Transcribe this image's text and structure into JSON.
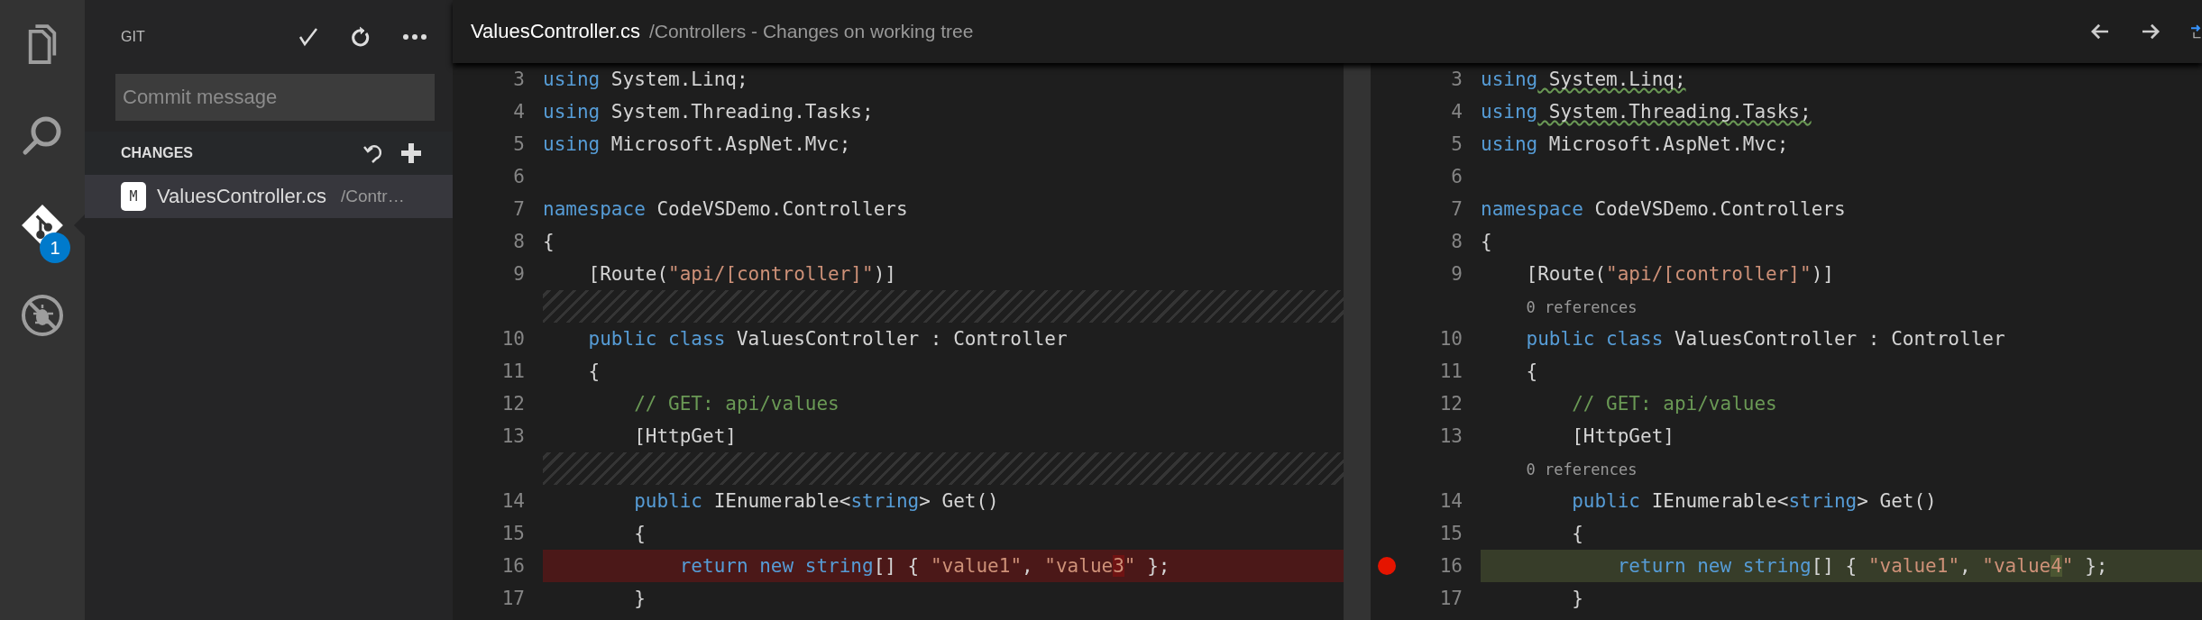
{
  "activity_bar": {
    "items": [
      {
        "kind": "files",
        "selected": false
      },
      {
        "kind": "search",
        "selected": false
      },
      {
        "kind": "git",
        "selected": true,
        "badge": "1"
      },
      {
        "kind": "debug",
        "selected": false
      }
    ]
  },
  "sidebar": {
    "title": "GIT",
    "commit_message": {
      "placeholder": "Commit message"
    },
    "section": {
      "title": "CHANGES"
    },
    "files": [
      {
        "status": "M",
        "name": "ValuesController.cs",
        "path": "/Contr…",
        "selected": true
      }
    ]
  },
  "editor": {
    "title": "ValuesController.cs",
    "description": "/Controllers - Changes on working tree",
    "panes": [
      {
        "lines": [
          {
            "kind": "code",
            "number": "3",
            "changed": false,
            "tokens": [
              {
                "kind": "keyword",
                "text": "using"
              },
              {
                "kind": "plain",
                "text": " System.Linq;"
              }
            ]
          },
          {
            "kind": "code",
            "number": "4",
            "changed": false,
            "tokens": [
              {
                "kind": "keyword",
                "text": "using"
              },
              {
                "kind": "plain",
                "text": " System.Threading.Tasks;"
              }
            ]
          },
          {
            "kind": "code",
            "number": "5",
            "changed": false,
            "tokens": [
              {
                "kind": "keyword",
                "text": "using"
              },
              {
                "kind": "plain",
                "text": " Microsoft.AspNet.Mvc;"
              }
            ]
          },
          {
            "kind": "code",
            "number": "6",
            "changed": false
          },
          {
            "kind": "code",
            "number": "7",
            "changed": false,
            "tokens": [
              {
                "kind": "keyword",
                "text": "namespace"
              },
              {
                "kind": "plain",
                "text": " CodeVSDemo.Controllers"
              }
            ]
          },
          {
            "kind": "code",
            "number": "8",
            "changed": false,
            "tokens": [
              {
                "kind": "plain",
                "text": "{"
              }
            ]
          },
          {
            "kind": "code",
            "number": "9",
            "changed": false,
            "tokens": [
              {
                "kind": "plain",
                "text": "    [Route("
              },
              {
                "kind": "string",
                "text": "\"api/[controller]\""
              },
              {
                "kind": "plain",
                "text": ")]"
              }
            ]
          },
          {
            "kind": "filler"
          },
          {
            "kind": "code",
            "number": "10",
            "changed": false,
            "tokens": [
              {
                "kind": "keyword",
                "text": "    public class"
              },
              {
                "kind": "plain",
                "text": " ValuesController : Controller"
              }
            ]
          },
          {
            "kind": "code",
            "number": "11",
            "changed": false,
            "tokens": [
              {
                "kind": "plain",
                "text": "    {"
              }
            ]
          },
          {
            "kind": "code",
            "number": "12",
            "changed": false,
            "tokens": [
              {
                "kind": "comment",
                "text": "        // GET: api/values"
              }
            ]
          },
          {
            "kind": "code",
            "number": "13",
            "changed": false,
            "tokens": [
              {
                "kind": "plain",
                "text": "        [HttpGet]"
              }
            ]
          },
          {
            "kind": "filler"
          },
          {
            "kind": "code",
            "number": "14",
            "changed": false,
            "tokens": [
              {
                "kind": "keyword",
                "text": "        public"
              },
              {
                "kind": "plain",
                "text": " IEnumerable<"
              },
              {
                "kind": "keyword",
                "text": "string"
              },
              {
                "kind": "plain",
                "text": "> Get()"
              }
            ]
          },
          {
            "kind": "code",
            "number": "15",
            "changed": false,
            "tokens": [
              {
                "kind": "plain",
                "text": "        {"
              }
            ]
          },
          {
            "kind": "code",
            "number": "16",
            "changed": true,
            "tokens": [
              {
                "kind": "keyword",
                "text": "            return new string"
              },
              {
                "kind": "plain",
                "text": "[] { "
              },
              {
                "kind": "string",
                "text": "\"value1\""
              },
              {
                "kind": "plain",
                "text": ", "
              },
              {
                "kind": "string",
                "text": "\"value"
              },
              {
                "kind": "string-changed",
                "text": "3"
              },
              {
                "kind": "string",
                "text": "\""
              },
              {
                "kind": "plain",
                "text": " };"
              }
            ]
          },
          {
            "kind": "code",
            "number": "17",
            "changed": false,
            "tokens": [
              {
                "kind": "plain",
                "text": "        }"
              }
            ]
          }
        ]
      },
      {
        "lines": [
          {
            "kind": "code",
            "number": "3",
            "changed": false,
            "breakpoint": false,
            "tokens": [
              {
                "kind": "keyword",
                "text": "using"
              },
              {
                "kind": "warning",
                "text": " System.Linq;"
              }
            ]
          },
          {
            "kind": "code",
            "number": "4",
            "changed": false,
            "breakpoint": false,
            "tokens": [
              {
                "kind": "keyword",
                "text": "using"
              },
              {
                "kind": "warning",
                "text": " System.Threading.Tasks;"
              }
            ]
          },
          {
            "kind": "code",
            "number": "5",
            "changed": false,
            "breakpoint": false,
            "tokens": [
              {
                "kind": "keyword",
                "text": "using"
              },
              {
                "kind": "plain",
                "text": " Microsoft.AspNet.Mvc;"
              }
            ]
          },
          {
            "kind": "code",
            "number": "6",
            "changed": false,
            "breakpoint": false
          },
          {
            "kind": "code",
            "number": "7",
            "changed": false,
            "breakpoint": false,
            "tokens": [
              {
                "kind": "keyword",
                "text": "namespace"
              },
              {
                "kind": "plain",
                "text": " CodeVSDemo.Controllers"
              }
            ]
          },
          {
            "kind": "code",
            "number": "8",
            "changed": false,
            "breakpoint": false,
            "tokens": [
              {
                "kind": "plain",
                "text": "{"
              }
            ]
          },
          {
            "kind": "code",
            "number": "9",
            "changed": false,
            "breakpoint": false,
            "tokens": [
              {
                "kind": "plain",
                "text": "    [Route("
              },
              {
                "kind": "string",
                "text": "\"api/[controller]\""
              },
              {
                "kind": "plain",
                "text": ")]"
              }
            ]
          },
          {
            "kind": "codelens",
            "text": "0 references"
          },
          {
            "kind": "code",
            "number": "10",
            "changed": false,
            "breakpoint": false,
            "tokens": [
              {
                "kind": "keyword",
                "text": "    public class"
              },
              {
                "kind": "plain",
                "text": " ValuesController : Controller"
              }
            ]
          },
          {
            "kind": "code",
            "number": "11",
            "changed": false,
            "breakpoint": false,
            "tokens": [
              {
                "kind": "plain",
                "text": "    {"
              }
            ]
          },
          {
            "kind": "code",
            "number": "12",
            "changed": false,
            "breakpoint": false,
            "tokens": [
              {
                "kind": "comment",
                "text": "        // GET: api/values"
              }
            ]
          },
          {
            "kind": "code",
            "number": "13",
            "changed": false,
            "breakpoint": false,
            "tokens": [
              {
                "kind": "plain",
                "text": "        [HttpGet]"
              }
            ]
          },
          {
            "kind": "codelens",
            "text": "0 references"
          },
          {
            "kind": "code",
            "number": "14",
            "changed": false,
            "breakpoint": false,
            "tokens": [
              {
                "kind": "keyword",
                "text": "        public"
              },
              {
                "kind": "plain",
                "text": " IEnumerable<"
              },
              {
                "kind": "keyword",
                "text": "string"
              },
              {
                "kind": "plain",
                "text": "> Get()"
              }
            ]
          },
          {
            "kind": "code",
            "number": "15",
            "changed": false,
            "breakpoint": false,
            "tokens": [
              {
                "kind": "plain",
                "text": "        {"
              }
            ]
          },
          {
            "kind": "code",
            "number": "16",
            "changed": true,
            "breakpoint": true,
            "tokens": [
              {
                "kind": "keyword",
                "text": "            return new string"
              },
              {
                "kind": "plain",
                "text": "[] { "
              },
              {
                "kind": "string",
                "text": "\"value1\""
              },
              {
                "kind": "plain",
                "text": ", "
              },
              {
                "kind": "string",
                "text": "\"value"
              },
              {
                "kind": "string-changed",
                "text": "4"
              },
              {
                "kind": "string",
                "text": "\""
              },
              {
                "kind": "plain",
                "text": " };"
              }
            ]
          },
          {
            "kind": "code",
            "number": "17",
            "changed": false,
            "breakpoint": false,
            "tokens": [
              {
                "kind": "plain",
                "text": "        }"
              }
            ]
          }
        ]
      }
    ]
  }
}
